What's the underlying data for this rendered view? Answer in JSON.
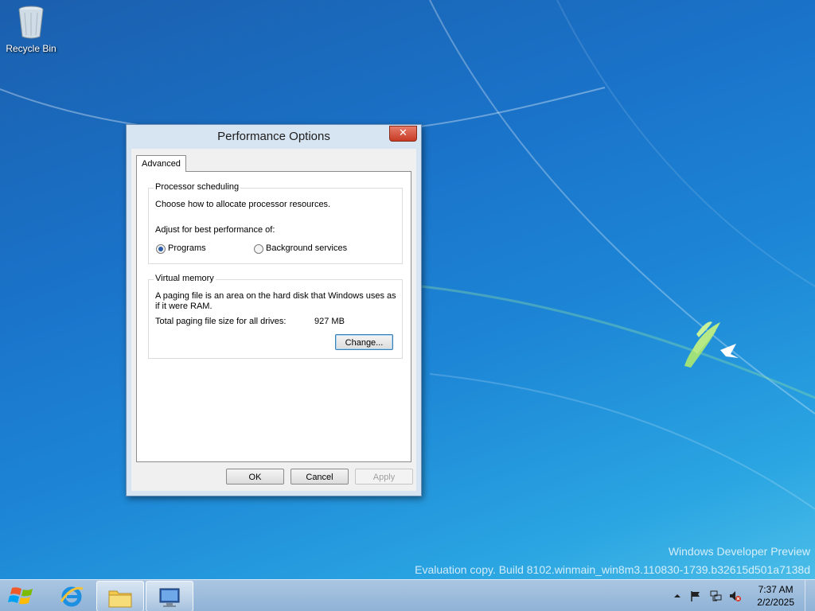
{
  "desktop": {
    "icons": [
      {
        "label": "Recycle Bin",
        "icon": "recycle-bin-icon"
      }
    ],
    "watermark": {
      "line1": "Windows Developer Preview",
      "line2": "Evaluation copy. Build 8102.winmain_win8m3.110830-1739.b32615d501a7138d"
    }
  },
  "dialog": {
    "title": "Performance Options",
    "close_label": "✕",
    "tabs": [
      {
        "label": "Advanced",
        "selected": true
      }
    ],
    "processor_scheduling": {
      "legend": "Processor scheduling",
      "description": "Choose how to allocate processor resources.",
      "adjust_label": "Adjust for best performance of:",
      "options": [
        {
          "label": "Programs",
          "selected": true
        },
        {
          "label": "Background services",
          "selected": false
        }
      ]
    },
    "virtual_memory": {
      "legend": "Virtual memory",
      "description_line1": "A paging file is an area on the hard disk that Windows uses as",
      "description_line2": "if it were RAM.",
      "total_label": "Total paging file size for all drives:",
      "total_value": "927 MB",
      "change_button": "Change..."
    },
    "buttons": {
      "ok": "OK",
      "cancel": "Cancel",
      "apply": "Apply"
    }
  },
  "taskbar": {
    "items": [
      {
        "icon": "internet-explorer-icon",
        "active": false
      },
      {
        "icon": "file-explorer-icon",
        "active": true
      },
      {
        "icon": "system-properties-icon",
        "active": true
      }
    ],
    "tray": {
      "icons": [
        "show-hidden-icons-arrow-icon",
        "action-center-flag-icon",
        "network-icon",
        "volume-muted-icon"
      ]
    },
    "clock": {
      "time": "7:37 AM",
      "date": "2/2/2025"
    }
  },
  "colors": {
    "desktop_top": "#1b5fae",
    "desktop_bottom": "#4bbde8",
    "dialog_frame": "#d7e4f1",
    "close_button": "#c73b24",
    "taskbar": "#9dbcdc"
  }
}
